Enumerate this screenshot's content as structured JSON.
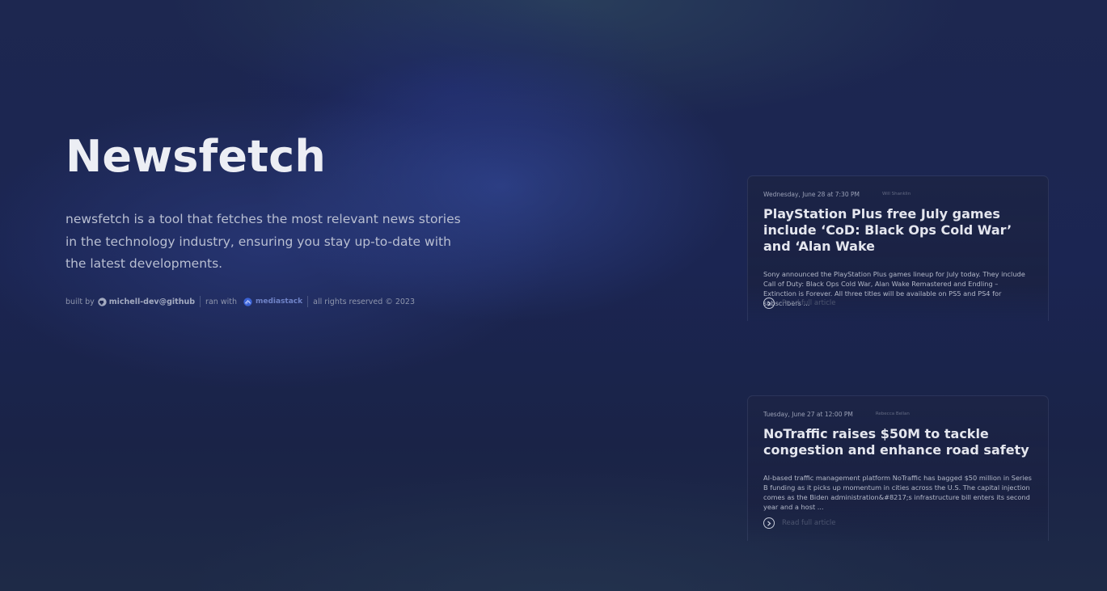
{
  "hero": {
    "title": "Newsfetch",
    "description": "newsfetch is a tool that fetches the most relevant news stories in the technology industry, ensuring you stay up-to-date with the latest developments."
  },
  "credits": {
    "built_by_prefix": "built by",
    "github_icon": "github-icon",
    "github_user": "michell-dev@github",
    "ran_with_prefix": "ran with",
    "mediastack_icon": "mediastack-icon",
    "mediastack_label": "mediastack",
    "rights": "all rights reserved © 2023"
  },
  "articles": [
    {
      "date": "Wednesday, June 28 at 7:30 PM",
      "author": "Will Shanklin",
      "title": "PlayStation Plus free July games include ‘CoD: Black Ops Cold War’ and ‘Alan Wake",
      "description": "Sony announced the PlayStation Plus games lineup for July today. They include Call of Duty: Black Ops Cold War, Alan Wake Remastered and Endling – Extinction is Forever. All three titles will be available on PS5 and PS4 for subscribers ...",
      "read_label": "Read full article",
      "read_icon": "chevron-right-circle-icon"
    },
    {
      "date": "Tuesday, June 27 at 12:00 PM",
      "author": "Rebecca Bellan",
      "title": "NoTraffic raises $50M to tackle congestion and enhance road safety",
      "description": "AI-based traffic management platform NoTraffic has bagged $50 million in Series B funding as it picks up momentum in cities across the U.S. The capital injection comes as the Biden administration&#8217;s infrastructure bill enters its second year and a host ...",
      "read_label": "Read full article",
      "read_icon": "chevron-right-circle-icon"
    }
  ],
  "colors": {
    "background": "#1b2552",
    "accent": "#6f83c7",
    "title_text": "#eceef4",
    "muted_text": "#8f96ad"
  }
}
